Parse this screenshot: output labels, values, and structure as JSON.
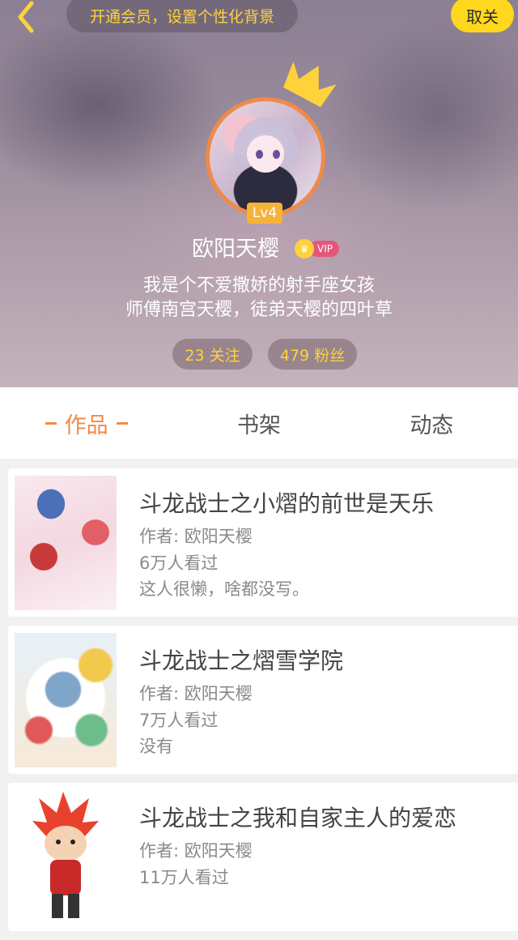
{
  "header": {
    "member_prompt": "开通会员，设置个性化背景",
    "unfollow_label": "取关",
    "level": "Lv4",
    "user_name": "欧阳天樱",
    "vip_label": "VIP",
    "bio_line1": "我是个不爱撒娇的射手座女孩",
    "bio_line2": "师傅南宫天樱，徒弟天樱的四叶草",
    "following": "23 关注",
    "fans": "479 粉丝"
  },
  "tabs": [
    {
      "label": "作品",
      "active": true
    },
    {
      "label": "书架",
      "active": false
    },
    {
      "label": "动态",
      "active": false
    }
  ],
  "works": [
    {
      "title": "斗龙战士之小熠的前世是天乐",
      "author": "作者: 欧阳天樱",
      "views": "6万人看过",
      "description": "这人很懒，啥都没写。"
    },
    {
      "title": "斗龙战士之熠雪学院",
      "author": "作者: 欧阳天樱",
      "views": "7万人看过",
      "description": "没有"
    },
    {
      "title": "斗龙战士之我和自家主人的爱恋",
      "author": "作者: 欧阳天樱",
      "views": "11万人看过",
      "description": ""
    }
  ],
  "colors": {
    "accent": "#f08a48",
    "member_text": "#ffd23c",
    "unfollow_bg": "#ffd81e"
  },
  "icons": [
    "back-arrow-icon",
    "crown-icon",
    "vip-crown-icon"
  ]
}
